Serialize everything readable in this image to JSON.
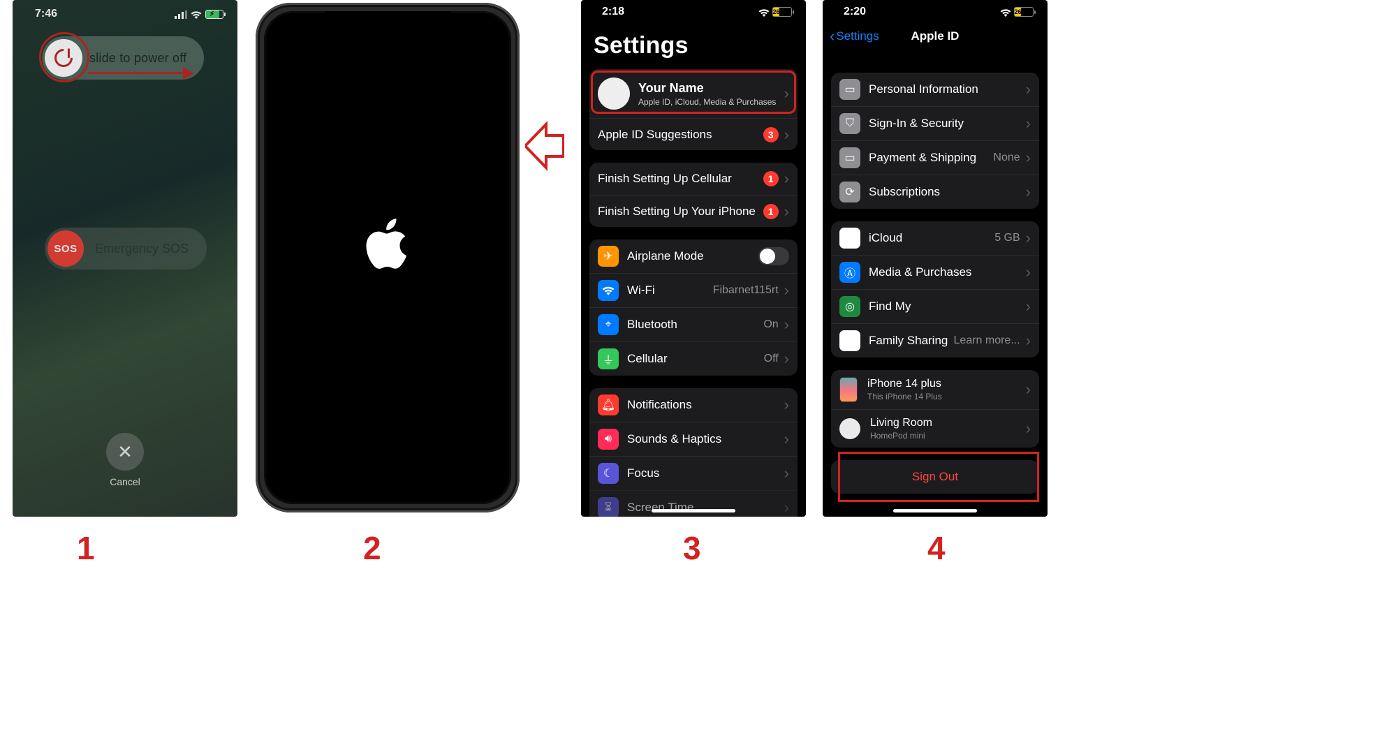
{
  "step_labels": {
    "s1": "1",
    "s2": "2",
    "s3": "3",
    "s4": "4"
  },
  "panel1": {
    "time": "7:46",
    "slide_label": "slide to power off",
    "sos_knob": "SOS",
    "sos_label": "Emergency SOS",
    "cancel_label": "Cancel"
  },
  "panel3": {
    "time": "2:18",
    "battery_pct": "26",
    "title": "Settings",
    "profile": {
      "name": "Your Name",
      "sub": "Apple ID, iCloud, Media & Purchases"
    },
    "rows": {
      "suggestions": {
        "label": "Apple ID Suggestions",
        "badge": "3"
      },
      "cellular_setup": {
        "label": "Finish Setting Up Cellular",
        "badge": "1"
      },
      "iphone_setup": {
        "label": "Finish Setting Up Your iPhone",
        "badge": "1"
      },
      "airplane": {
        "label": "Airplane Mode"
      },
      "wifi": {
        "label": "Wi-Fi",
        "value": "Fibarnet115rt"
      },
      "bluetooth": {
        "label": "Bluetooth",
        "value": "On"
      },
      "cellular": {
        "label": "Cellular",
        "value": "Off"
      },
      "notifications": {
        "label": "Notifications"
      },
      "sounds": {
        "label": "Sounds & Haptics"
      },
      "focus": {
        "label": "Focus"
      },
      "screentime": {
        "label": "Screen Time"
      }
    }
  },
  "panel4": {
    "time": "2:20",
    "battery_pct": "26",
    "back_label": "Settings",
    "title": "Apple ID",
    "rows": {
      "personal": {
        "label": "Personal Information"
      },
      "signin": {
        "label": "Sign-In & Security"
      },
      "payment": {
        "label": "Payment & Shipping",
        "value": "None"
      },
      "subs": {
        "label": "Subscriptions"
      },
      "icloud": {
        "label": "iCloud",
        "value": "5 GB"
      },
      "media": {
        "label": "Media & Purchases"
      },
      "findmy": {
        "label": "Find My"
      },
      "family": {
        "label": "Family Sharing",
        "value": "Learn more..."
      },
      "dev1": {
        "name": "iPhone 14 plus",
        "sub": "This iPhone 14 Plus"
      },
      "dev2": {
        "name": "Living Room",
        "sub": "HomePod mini"
      }
    },
    "signout": "Sign Out"
  }
}
